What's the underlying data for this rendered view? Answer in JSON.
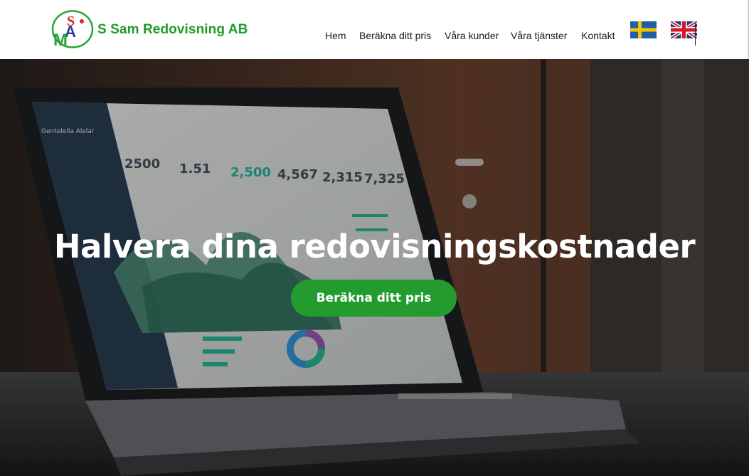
{
  "brand": {
    "name": "S Sam Redovisning AB",
    "logo_letters": [
      "S",
      "A",
      "M"
    ]
  },
  "nav": {
    "items": [
      {
        "label": "Hem"
      },
      {
        "label": "Beräkna ditt pris"
      },
      {
        "label": "Våra kunder"
      },
      {
        "label": "Våra tjänster"
      },
      {
        "label": "Kontakt"
      }
    ],
    "languages": [
      "swedish-flag-icon",
      "uk-flag-icon"
    ]
  },
  "hero": {
    "title": "Halvera dina redovisningskostnader",
    "cta_label": "Beräkna ditt pris",
    "background_image": "laptop-dashboard-photo",
    "dashboard_stats": [
      "2500",
      "1.51",
      "2,500",
      "4,567",
      "2,315",
      "7,325"
    ],
    "dashboard_sidebar_title": "Gentelella Alela!"
  },
  "colors": {
    "brand_green": "#1f9b2a",
    "cta_green": "#239b2f",
    "logo_red": "#d9262e",
    "logo_blue": "#2b3f95",
    "nav_text": "#1a1a1a"
  }
}
